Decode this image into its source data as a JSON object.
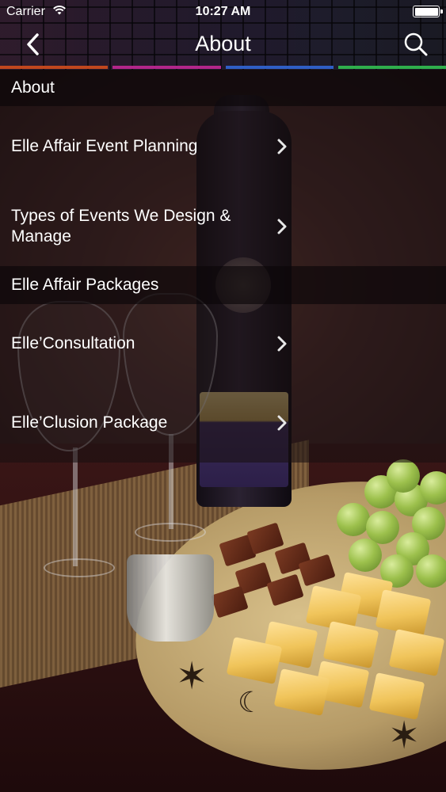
{
  "status_bar": {
    "carrier": "Carrier",
    "time": "10:27 AM"
  },
  "nav": {
    "title": "About",
    "back_icon": "chevron-left-icon",
    "search_icon": "search-icon"
  },
  "tab_strip_colors": [
    "#c0471e",
    "#b2268a",
    "#2f5ec4",
    "#2fae4c"
  ],
  "sections": [
    {
      "header": "About",
      "items": [
        {
          "label": "Elle Affair Event Planning"
        },
        {
          "label": "Types of Events We Design & Manage"
        }
      ]
    },
    {
      "header": "Elle Affair Packages",
      "items": [
        {
          "label": "Elle’Consultation"
        },
        {
          "label": "Elle’Clusion Package"
        }
      ]
    }
  ]
}
